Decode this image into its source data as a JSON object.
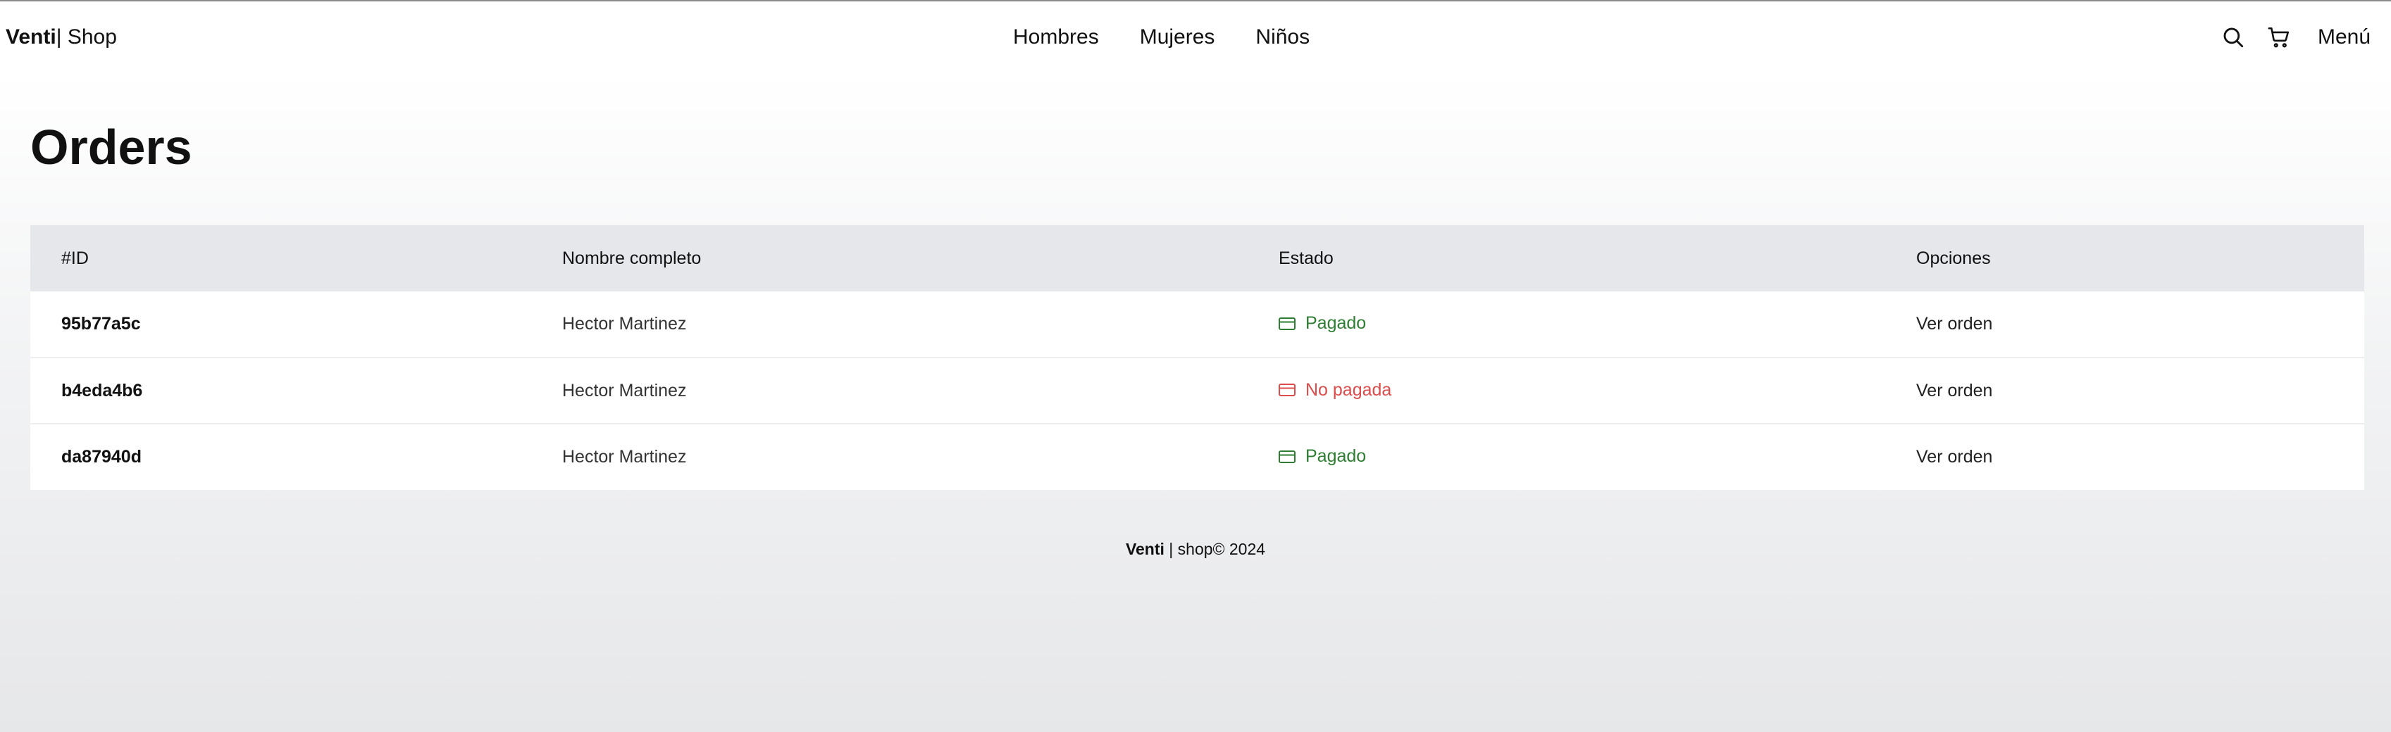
{
  "header": {
    "brand_bold": "Venti",
    "brand_sep": "|",
    "brand_rest": " Shop",
    "nav": [
      {
        "label": "Hombres"
      },
      {
        "label": "Mujeres"
      },
      {
        "label": "Niños"
      }
    ],
    "search_icon": "search-icon",
    "cart_icon": "cart-icon",
    "menu_label": "Menú"
  },
  "page": {
    "title": "Orders"
  },
  "table": {
    "columns": [
      "#ID",
      "Nombre completo",
      "Estado",
      "Opciones"
    ],
    "rows": [
      {
        "id": "95b77a5c",
        "name": "Hector Martinez",
        "status": "Pagado",
        "paid": true,
        "option": "Ver orden"
      },
      {
        "id": "b4eda4b6",
        "name": "Hector Martinez",
        "status": "No pagada",
        "paid": false,
        "option": "Ver orden"
      },
      {
        "id": "da87940d",
        "name": "Hector Martinez",
        "status": "Pagado",
        "paid": true,
        "option": "Ver orden"
      }
    ]
  },
  "colors": {
    "paid": "#2e7d32",
    "unpaid": "#dc4c4c",
    "table_header_bg": "#e5e7eb"
  },
  "footer": {
    "brand_bold": "Venti",
    "rest": " | shop© 2024"
  }
}
